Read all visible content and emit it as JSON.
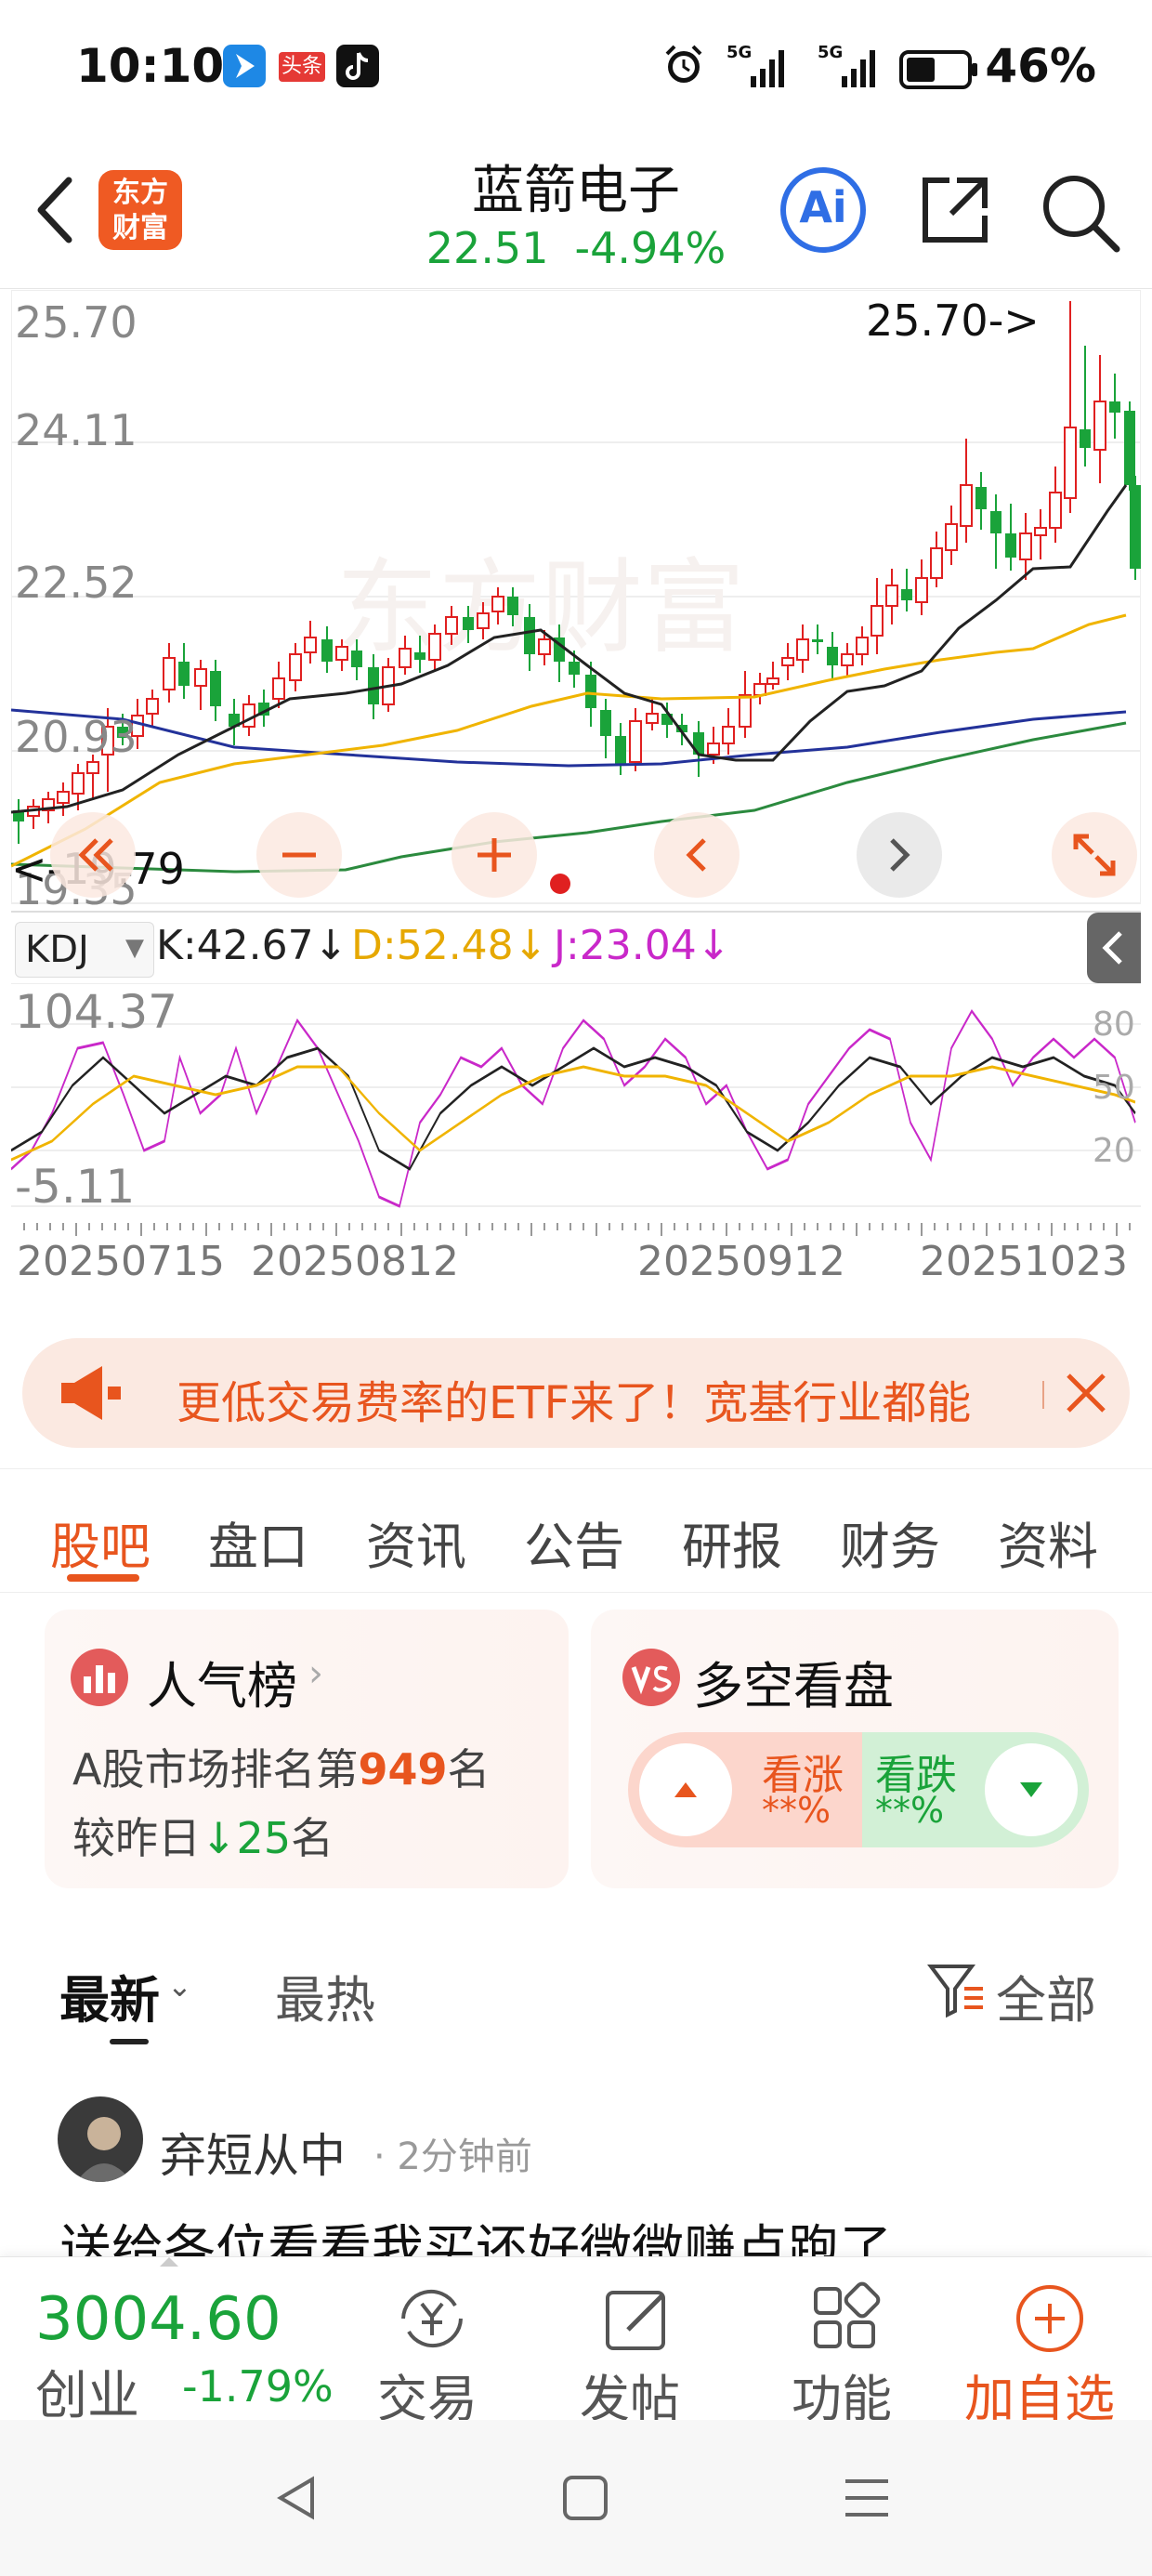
{
  "status_bar": {
    "time": "10:10",
    "app_badge": "头条",
    "signal1": "5G",
    "signal2": "5G",
    "battery": "46%"
  },
  "header": {
    "logo": "东方\n财富",
    "logo_line1": "东方",
    "logo_line2": "财富",
    "title": "蓝箭电子",
    "price": "22.51",
    "change": "-4.94%",
    "ai_label": "Ai"
  },
  "chart": {
    "price_labels": [
      "25.70",
      "24.11",
      "22.52",
      "20.93",
      "19.35"
    ],
    "high_marker": "25.70->",
    "low_marker": "<-19.79",
    "kdj": {
      "selector": "KDJ",
      "k": "K:42.67↓",
      "d": "D:52.48↓",
      "j": "J:23.04↓"
    },
    "kdj_axis_left": [
      "104.37",
      "-5.11"
    ],
    "kdj_axis_right": [
      "80",
      "50",
      "20"
    ],
    "dates": [
      "20250715",
      "20250812",
      "20250912",
      "20251023"
    ],
    "watermark": "东方财富"
  },
  "chart_data": {
    "type": "candlestick",
    "ylim": [
      19.35,
      25.7
    ],
    "indicator": "KDJ",
    "kdj_latest": {
      "K": 42.67,
      "D": 52.48,
      "J": 23.04
    },
    "x_ticks": [
      "20250715",
      "20250812",
      "20250912",
      "20251023"
    ]
  },
  "ad": {
    "text": "更低交易费率的ETF来了！宽基行业都能"
  },
  "tabs": [
    "股吧",
    "盘口",
    "资讯",
    "公告",
    "研报",
    "财务",
    "资料"
  ],
  "cards": {
    "popularity": {
      "title": "人气榜",
      "rank_prefix": "A股市场排名第",
      "rank": "949",
      "rank_suffix": "名",
      "change_prefix": "较昨日",
      "change_value": "25",
      "change_suffix": "名"
    },
    "vote": {
      "title": "多空看盘",
      "bull": "看涨",
      "bull_pct": "**%",
      "bear": "看跌",
      "bear_pct": "**%"
    }
  },
  "feed": {
    "latest": "最新",
    "hot": "最热",
    "filter": "全部"
  },
  "post": {
    "author": "弃短从中",
    "time": "· 2分钟前",
    "text": "送给各位看看我买还好微微赚点跑了"
  },
  "bottom_bar": {
    "index_value": "3004.60",
    "index_name": "创业",
    "index_change": "-1.79%",
    "trade": "交易",
    "post": "发帖",
    "function": "功能",
    "add_watch": "加自选"
  }
}
